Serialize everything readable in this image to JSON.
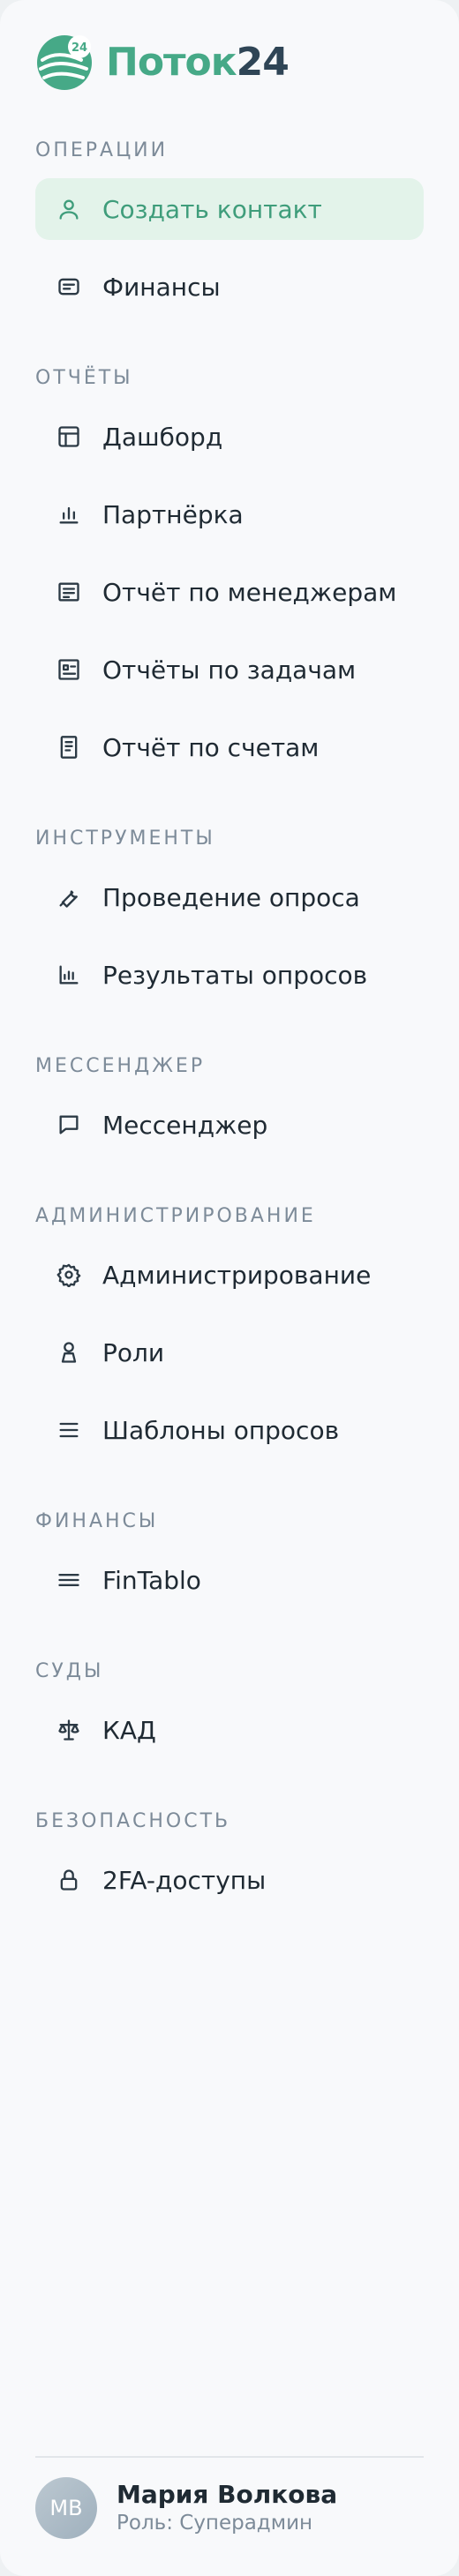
{
  "brand": {
    "name_a": "Поток",
    "name_b": "24",
    "badge": "24"
  },
  "sections": [
    {
      "title": "Операции",
      "items": [
        {
          "label": "Создать контакт",
          "icon": "user-icon",
          "active": true
        },
        {
          "label": "Финансы",
          "icon": "wallet-icon"
        }
      ]
    },
    {
      "title": "Отчёты",
      "items": [
        {
          "label": "Дашборд",
          "icon": "dashboard-icon"
        },
        {
          "label": "Партнёрка",
          "icon": "bar-chart-icon"
        },
        {
          "label": "Отчёт по менеджерам",
          "icon": "report-icon"
        },
        {
          "label": "Отчёты по задачам",
          "icon": "task-report-icon"
        },
        {
          "label": "Отчёт по счетам",
          "icon": "invoice-icon"
        }
      ]
    },
    {
      "title": "Инструменты",
      "items": [
        {
          "label": "Проведение опроса",
          "icon": "wrench-icon"
        },
        {
          "label": "Результаты опросов",
          "icon": "results-chart-icon"
        }
      ]
    },
    {
      "title": "Мессенджер",
      "items": [
        {
          "label": "Мессенджер",
          "icon": "chat-icon"
        }
      ]
    },
    {
      "title": "Администрирование",
      "items": [
        {
          "label": "Администрирование",
          "icon": "gear-icon"
        },
        {
          "label": "Роли",
          "icon": "person-icon"
        },
        {
          "label": "Шаблоны опросов",
          "icon": "list-icon"
        }
      ]
    },
    {
      "title": "Финансы",
      "items": [
        {
          "label": "FinTablo",
          "icon": "menu-icon"
        }
      ]
    },
    {
      "title": "Суды",
      "items": [
        {
          "label": "КАД",
          "icon": "scales-icon"
        }
      ]
    },
    {
      "title": "Безопасность",
      "items": [
        {
          "label": "2FA-доступы",
          "icon": "lock-icon"
        }
      ]
    }
  ],
  "user": {
    "initials": "МВ",
    "name": "Мария Волкова",
    "role": "Роль: Суперадмин"
  },
  "colors": {
    "accent": "#3f9d7b",
    "active_bg": "#e3f3ea",
    "brand_dark": "#2f4556"
  }
}
